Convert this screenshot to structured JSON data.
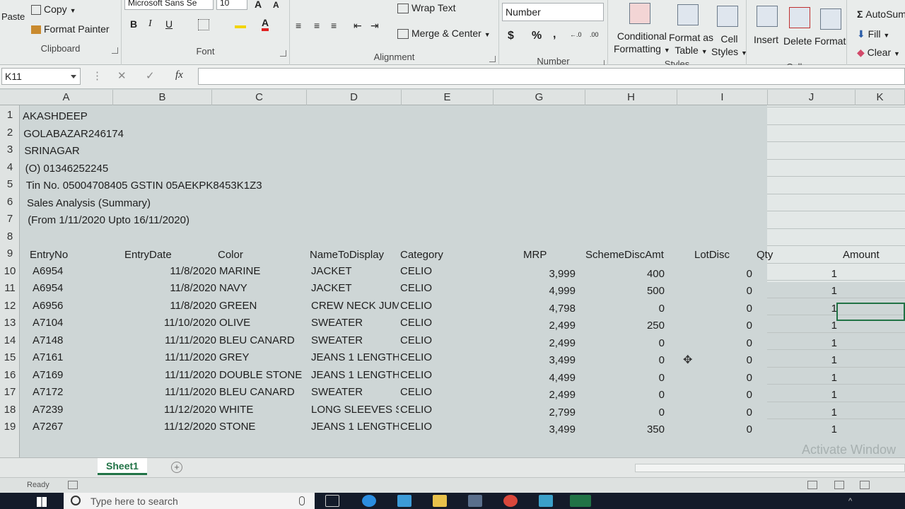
{
  "ribbon": {
    "clipboard": {
      "paste": "Paste",
      "copy": "Copy",
      "format_painter": "Format Painter",
      "label": "Clipboard"
    },
    "font": {
      "name": "Microsoft Sans Se",
      "size": "10",
      "label": "Font"
    },
    "alignment": {
      "wrap_text": "Wrap Text",
      "merge_center": "Merge & Center",
      "label": "Alignment"
    },
    "number": {
      "format": "Number",
      "currency": "$",
      "percent": "%",
      "comma": ",",
      "label": "Number"
    },
    "styles": {
      "conditional": "Conditional",
      "conditional2": "Formatting",
      "format_table": "Format as",
      "format_table2": "Table",
      "cell_styles": "Cell",
      "cell_styles2": "Styles",
      "label": "Styles"
    },
    "cells": {
      "insert": "Insert",
      "delete": "Delete",
      "format": "Format",
      "label": "Cells"
    },
    "editing": {
      "autosum": "AutoSum",
      "fill": "Fill",
      "clear": "Clear"
    }
  },
  "formula_bar": {
    "name_box": "K11",
    "formula": ""
  },
  "columns": [
    "A",
    "B",
    "C",
    "D",
    "E",
    "G",
    "H",
    "I",
    "J",
    "K"
  ],
  "rows": [
    "1",
    "2",
    "3",
    "4",
    "5",
    "6",
    "7",
    "8",
    "9",
    "10",
    "11",
    "12",
    "13",
    "14",
    "15",
    "16",
    "17",
    "18",
    "19"
  ],
  "header_lines": [
    "AKASHDEEP",
    "GOLABAZAR246174",
    "SRINAGAR",
    "(O) 01346252245",
    "Tin No. 05004708405 GSTIN 05AEKPK8453K1Z3",
    "Sales Analysis (Summary)",
    "(From 1/11/2020 Upto 16/11/2020)"
  ],
  "table_headers": [
    "EntryNo",
    "EntryDate",
    "Color",
    "NameToDisplay",
    "Category",
    "MRP",
    "SchemeDiscAmt",
    "LotDisc",
    "Qty",
    "Amount"
  ],
  "table_rows": [
    [
      "A6954",
      "11/8/2020",
      "MARINE",
      "JACKET",
      "CELIO",
      "3,999",
      "400",
      "0",
      "1"
    ],
    [
      "A6954",
      "11/8/2020",
      "NAVY",
      "JACKET",
      "CELIO",
      "4,999",
      "500",
      "0",
      "1"
    ],
    [
      "A6956",
      "11/8/2020",
      "GREEN",
      "CREW NECK JUMF",
      "CELIO",
      "4,798",
      "0",
      "0",
      "1"
    ],
    [
      "A7104",
      "11/10/2020",
      "OLIVE",
      "SWEATER",
      "CELIO",
      "2,499",
      "250",
      "0",
      "1"
    ],
    [
      "A7148",
      "11/11/2020",
      "BLEU CANARD",
      "SWEATER",
      "CELIO",
      "2,499",
      "0",
      "0",
      "1"
    ],
    [
      "A7161",
      "11/11/2020",
      "GREY",
      "JEANS 1 LENGTH",
      "CELIO",
      "3,499",
      "0",
      "0",
      "1"
    ],
    [
      "A7169",
      "11/11/2020",
      "DOUBLE STONE",
      "JEANS 1 LENGTH",
      "CELIO",
      "4,499",
      "0",
      "0",
      "1"
    ],
    [
      "A7172",
      "11/11/2020",
      "BLEU CANARD",
      "SWEATER",
      "CELIO",
      "2,499",
      "0",
      "0",
      "1"
    ],
    [
      "A7239",
      "11/12/2020",
      "WHITE",
      "LONG SLEEVES SI",
      "CELIO",
      "2,799",
      "0",
      "0",
      "1"
    ],
    [
      "A7267",
      "11/12/2020",
      "STONE",
      "JEANS 1 LENGTH",
      "CELIO",
      "3,499",
      "350",
      "0",
      "1"
    ]
  ],
  "sheet_tab": "Sheet1",
  "status": "Ready",
  "taskbar": {
    "search_placeholder": "Type here to search"
  },
  "watermark": "Activate Window",
  "colors": {
    "excel_green": "#217346",
    "taskbar": "#141b2a"
  }
}
